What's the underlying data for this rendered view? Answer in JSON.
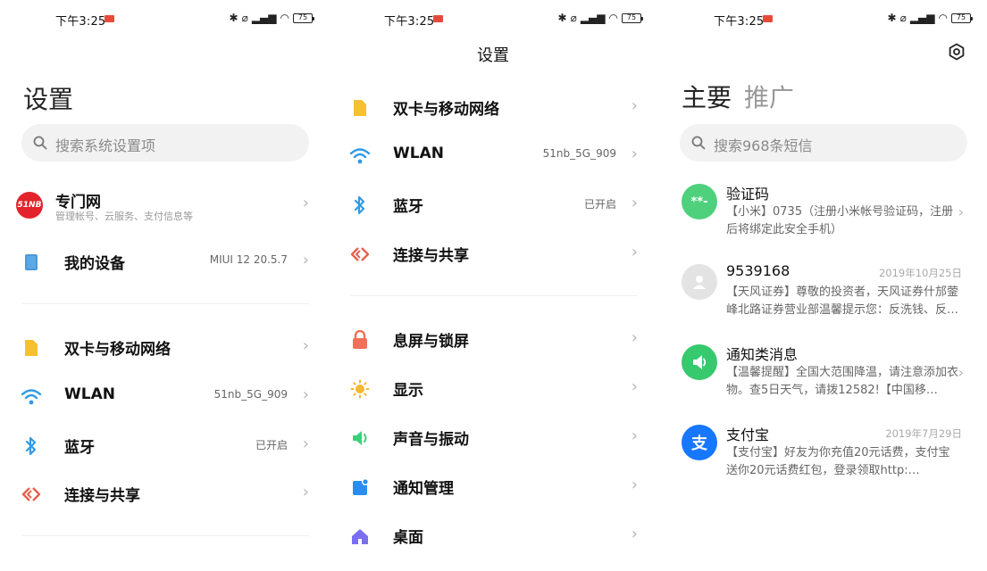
{
  "status_bar": {
    "time": "下午3:25",
    "battery": "75"
  },
  "panel1": {
    "title": "设置",
    "search_placeholder": "搜索系统设置项",
    "account": {
      "name": "专门网",
      "subtitle": "管理帐号、云服务、支付信息等",
      "logo_text": "51NB"
    },
    "device": {
      "label": "我的设备",
      "value": "MIUI 12 20.5.7"
    },
    "network_items": [
      {
        "label": "双卡与移动网络",
        "value": ""
      },
      {
        "label": "WLAN",
        "value": "51nb_5G_909"
      },
      {
        "label": "蓝牙",
        "value": "已开启"
      },
      {
        "label": "连接与共享",
        "value": ""
      }
    ]
  },
  "panel2": {
    "title": "设置",
    "network_items": [
      {
        "label": "双卡与移动网络",
        "value": ""
      },
      {
        "label": "WLAN",
        "value": "51nb_5G_909"
      },
      {
        "label": "蓝牙",
        "value": "已开启"
      },
      {
        "label": "连接与共享",
        "value": ""
      }
    ],
    "display_items": [
      {
        "label": "息屏与锁屏"
      },
      {
        "label": "显示"
      },
      {
        "label": "声音与振动"
      },
      {
        "label": "通知管理"
      },
      {
        "label": "桌面"
      }
    ]
  },
  "panel3": {
    "tabs": {
      "main": "主要",
      "promo": "推广"
    },
    "search_placeholder": "搜索968条短信",
    "messages": [
      {
        "name": "验证码",
        "date": "",
        "body": "【小米】0735（注册小米帐号验证码，注册后将绑定此安全手机）",
        "avatar_text": "**-"
      },
      {
        "name": "9539168",
        "date": "2019年10月25日",
        "body": "【天风证券】尊敬的投资者，天风证券什邡蓥峰北路证券营业部温馨提示您：反洗钱、反…"
      },
      {
        "name": "通知类消息",
        "date": "",
        "body": "【温馨提醒】全国大范围降温，请注意添加衣物。查5日天气，请拨12582!【中国移…"
      },
      {
        "name": "支付宝",
        "date": "2019年7月29日",
        "body": "【支付宝】好友为你充值20元话费，支付宝送你20元话费红包，登录领取http:…",
        "avatar_text": "支"
      }
    ]
  },
  "colors": {
    "sim_yellow": "#f5c12e",
    "wifi_blue": "#2f9be6",
    "bluetooth_blue": "#2f9be6",
    "share_red": "#e8604c",
    "lock_red": "#f0705a",
    "display_yellow": "#f5b731",
    "sound_green": "#3ccf7a",
    "notify_blue": "#2a8ef0",
    "home_purple": "#7b6ff0",
    "verify_green": "#4fd07d",
    "alipay_blue": "#1677ff"
  },
  "icons": {
    "chevron": "›"
  }
}
